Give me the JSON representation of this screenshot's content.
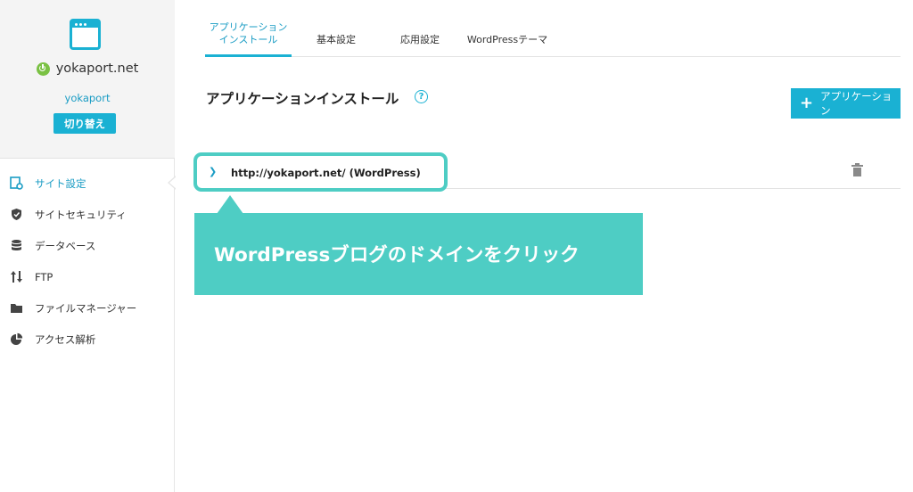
{
  "sidebar": {
    "domain": "yokaport.net",
    "account": "yokaport",
    "switch_label": "切り替え",
    "items": [
      {
        "label": "サイト設定",
        "icon": "site-settings-icon",
        "active": true
      },
      {
        "label": "サイトセキュリティ",
        "icon": "shield-icon",
        "active": false
      },
      {
        "label": "データベース",
        "icon": "database-icon",
        "active": false
      },
      {
        "label": "FTP",
        "icon": "updown-arrows-icon",
        "active": false
      },
      {
        "label": "ファイルマネージャー",
        "icon": "folder-icon",
        "active": false
      },
      {
        "label": "アクセス解析",
        "icon": "pie-chart-icon",
        "active": false
      }
    ]
  },
  "tabs": [
    {
      "line1": "アプリケーション",
      "line2": "インストール",
      "active": true
    },
    {
      "line1": "基本設定",
      "line2": "",
      "active": false
    },
    {
      "line1": "応用設定",
      "line2": "",
      "active": false
    },
    {
      "line1": "WordPressテーマ",
      "line2": "",
      "active": false
    }
  ],
  "main": {
    "title": "アプリケーションインストール",
    "help_symbol": "?",
    "add_button_label": "アプリケーション",
    "app_url": "http://yokaport.net/ (WordPress)"
  },
  "annotation": {
    "text": "WordPressブログのドメインをクリック"
  },
  "colors": {
    "accent": "#1ab1d3",
    "callout": "#4ecdc4",
    "power": "#7ac143"
  }
}
